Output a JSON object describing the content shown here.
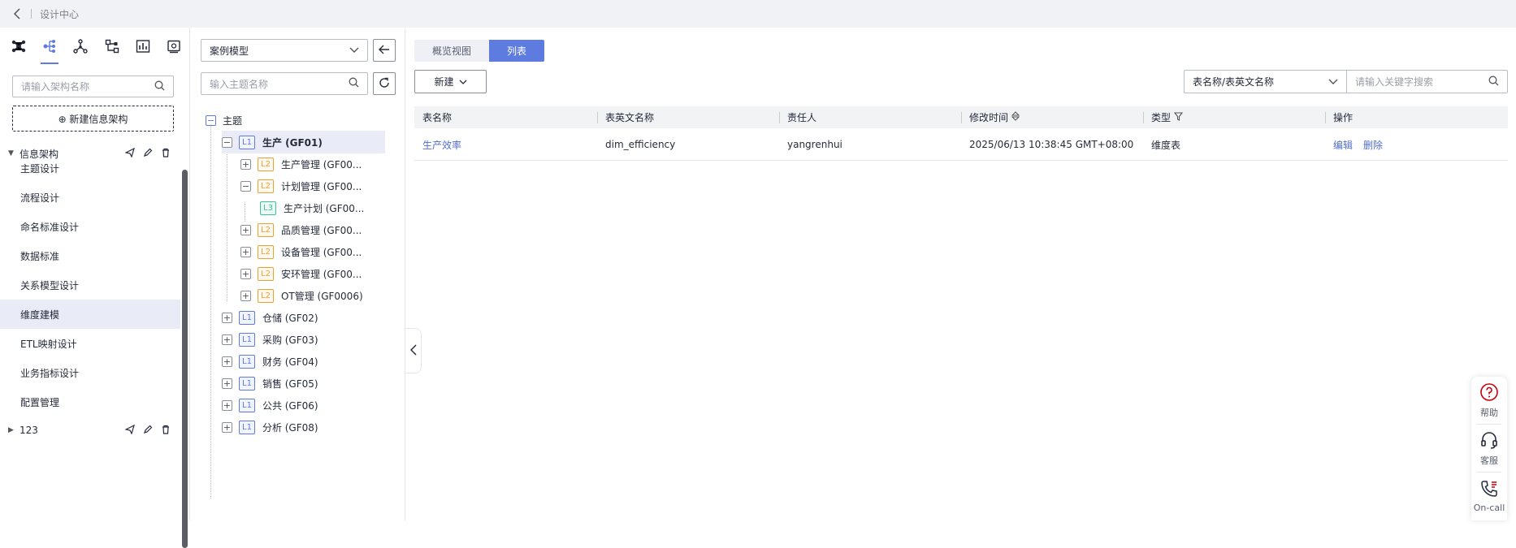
{
  "topbar": {
    "breadcrumb": "设计中心"
  },
  "left": {
    "iconbar": [
      "model-icon",
      "tree-icon",
      "network-icon",
      "flow-icon",
      "chart-icon",
      "book-icon"
    ],
    "search_placeholder": "请输入架构名称",
    "new_arch_label": "⊕ 新建信息架构",
    "archs": [
      {
        "name": "信息架构"
      },
      {
        "name": "123"
      }
    ],
    "menu": [
      "主题设计",
      "流程设计",
      "命名标准设计",
      "数据标准",
      "关系模型设计",
      "维度建模",
      "ETL映射设计",
      "业务指标设计",
      "配置管理"
    ],
    "active_menu": "维度建模"
  },
  "tree": {
    "model_select": "案例模型",
    "search_placeholder": "输入主题名称",
    "root": "主题",
    "nodes": [
      {
        "level": "L1",
        "label": "生产 (GF01)"
      },
      {
        "level": "L2",
        "label": "生产管理 (GF00..."
      },
      {
        "level": "L2",
        "label": "计划管理 (GF00..."
      },
      {
        "level": "L3",
        "label": "生产计划 (GF00..."
      },
      {
        "level": "L2",
        "label": "品质管理 (GF00..."
      },
      {
        "level": "L2",
        "label": "设备管理 (GF00..."
      },
      {
        "level": "L2",
        "label": "安环管理 (GF00..."
      },
      {
        "level": "L2",
        "label": "OT管理 (GF0006)"
      },
      {
        "level": "L1",
        "label": "仓储 (GF02)"
      },
      {
        "level": "L1",
        "label": "采购 (GF03)"
      },
      {
        "level": "L1",
        "label": "财务 (GF04)"
      },
      {
        "level": "L1",
        "label": "销售 (GF05)"
      },
      {
        "level": "L1",
        "label": "公共 (GF06)"
      },
      {
        "level": "L1",
        "label": "分析 (GF08)"
      }
    ]
  },
  "main": {
    "tabs": [
      "概览视图",
      "列表"
    ],
    "new_button": "新建",
    "filter_field": "表名称/表英文名称",
    "filter_placeholder": "请输入关键字搜索",
    "columns": [
      "表名称",
      "表英文名称",
      "责任人",
      "修改时间",
      "类型",
      "操作"
    ],
    "rows": [
      {
        "name": "生产效率",
        "en_name": "dim_efficiency",
        "owner": "yangrenhui",
        "modified": "2025/06/13 10:38:45 GMT+08:00",
        "type": "维度表",
        "actions": [
          "编辑",
          "删除"
        ]
      }
    ]
  },
  "float": {
    "help": "帮助",
    "service": "客服",
    "oncall": "On-call"
  },
  "colors": {
    "accent": "#5e7ce0",
    "link": "#526ecc",
    "l2": "#f0a030",
    "l3": "#3ac295"
  }
}
